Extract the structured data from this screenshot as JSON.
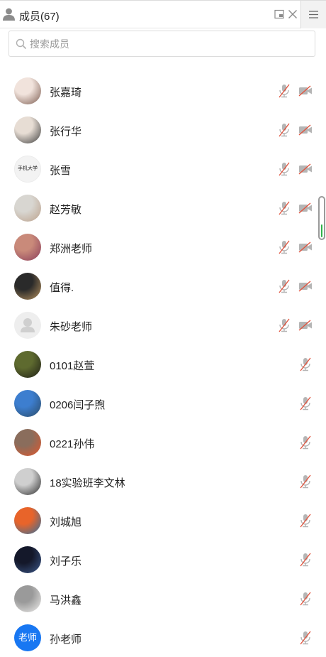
{
  "header": {
    "title": "成员(67)"
  },
  "search": {
    "placeholder": "搜索成员"
  },
  "members": [
    {
      "name": "张嘉琦",
      "video": true,
      "avatar": "photo",
      "colors": [
        "#f1e3dc",
        "#7a5a4e"
      ]
    },
    {
      "name": "张行华",
      "video": true,
      "avatar": "photo",
      "colors": [
        "#e7ddd4",
        "#3b3b3b"
      ]
    },
    {
      "name": "张雪",
      "video": true,
      "avatar": "text-logo",
      "logo_text": "手机大学",
      "colors": [
        "#f3f3f3",
        "#222222"
      ]
    },
    {
      "name": "赵芳敏",
      "video": true,
      "avatar": "photo",
      "colors": [
        "#d8d6d1",
        "#bba08a"
      ]
    },
    {
      "name": "郑洲老师",
      "video": true,
      "avatar": "photo",
      "colors": [
        "#c98a7a",
        "#8a3c5a"
      ]
    },
    {
      "name": "值得.",
      "video": true,
      "avatar": "photo",
      "colors": [
        "#2a2a2a",
        "#b9935f"
      ]
    },
    {
      "name": "朱砂老师",
      "video": true,
      "avatar": "default",
      "colors": [
        "#eeeeee",
        "#d0d0d0"
      ]
    },
    {
      "name": "0101赵萱",
      "video": false,
      "avatar": "photo",
      "colors": [
        "#5e6a2f",
        "#1e1e16"
      ]
    },
    {
      "name": "0206闫子煦",
      "video": false,
      "avatar": "photo",
      "colors": [
        "#3d7ecf",
        "#2a4a66"
      ]
    },
    {
      "name": "0221孙伟",
      "video": false,
      "avatar": "photo",
      "colors": [
        "#8a6d5c",
        "#e2562b"
      ]
    },
    {
      "name": "18实验班李文林",
      "video": false,
      "avatar": "photo",
      "colors": [
        "#cfcfcf",
        "#2b2b2b"
      ]
    },
    {
      "name": "刘城旭",
      "video": false,
      "avatar": "photo",
      "colors": [
        "#e8642a",
        "#2b6fa0"
      ]
    },
    {
      "name": "刘子乐",
      "video": false,
      "avatar": "photo",
      "colors": [
        "#14182a",
        "#3d5a8c"
      ]
    },
    {
      "name": "马洪鑫",
      "video": false,
      "avatar": "photo",
      "colors": [
        "#9a9a9a",
        "#f0efed"
      ]
    },
    {
      "name": "孙老师",
      "video": false,
      "avatar": "text",
      "avatar_text": "老师",
      "colors": [
        "#1877f2",
        "#1877f2"
      ]
    }
  ],
  "scroll": {
    "position_fraction": 0.62
  },
  "colors": {
    "accent": "#1877f2",
    "mute_red": "#e2513b",
    "icon_gray": "#b5b5b5",
    "scroll_green": "#2fb34a"
  }
}
